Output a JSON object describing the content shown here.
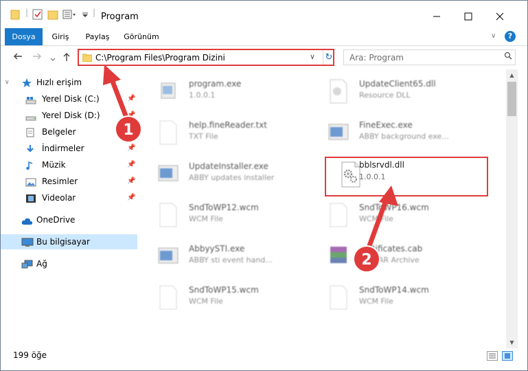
{
  "window": {
    "title": "Program"
  },
  "ribbon": {
    "tabs": [
      "Dosya",
      "Giriş",
      "Paylaş",
      "Görünüm"
    ]
  },
  "address": {
    "path": "C:\\Program Files\\Program Dizini"
  },
  "search": {
    "placeholder": "Ara: Program"
  },
  "nav_pane": {
    "items": [
      {
        "label": "Hızlı erişim",
        "icon": "star-icon"
      },
      {
        "label": "Yerel Disk (C:)",
        "icon": "drive-icon"
      },
      {
        "label": "Yerel Disk (D:)",
        "icon": "drive-icon"
      },
      {
        "label": "Belgeler",
        "icon": "documents-icon"
      },
      {
        "label": "İndirmeler",
        "icon": "download-icon"
      },
      {
        "label": "Müzik",
        "icon": "music-icon"
      },
      {
        "label": "Resimler",
        "icon": "pictures-icon"
      },
      {
        "label": "Videolar",
        "icon": "video-icon"
      },
      {
        "label": "OneDrive",
        "icon": "cloud-icon"
      },
      {
        "label": "Bu bilgisayar",
        "icon": "computer-icon"
      },
      {
        "label": "Ağ",
        "icon": "network-icon"
      }
    ]
  },
  "files": [
    {
      "name": "program.exe",
      "desc": "1.0.0.1"
    },
    {
      "name": "UpdateClient65.dll",
      "desc": "Resource DLL"
    },
    {
      "name": "help.fineReader.txt",
      "desc": "TXT File"
    },
    {
      "name": "FineExec.exe",
      "desc": "ABBY background exe..."
    },
    {
      "name": "UpdateInstaller.exe",
      "desc": "ABBY updates installer"
    },
    {
      "name": "bblsrvdl.dll",
      "desc": "1.0.0.1"
    },
    {
      "name": "SndToWP12.wcm",
      "desc": "WCM File"
    },
    {
      "name": "SndToWP16.wcm",
      "desc": "WCM File"
    },
    {
      "name": "AbbyySTI.exe",
      "desc": "ABBY sti event hand..."
    },
    {
      "name": "certificates.cab",
      "desc": "WinRAR Archive"
    },
    {
      "name": "SndToWP15.wcm",
      "desc": "WCM File"
    },
    {
      "name": "SndToWP14.wcm",
      "desc": "WCM File"
    }
  ],
  "status": {
    "item_count": "199 öğe"
  },
  "annotations": {
    "step1": "1",
    "step2": "2",
    "color": "#e03b3b"
  }
}
